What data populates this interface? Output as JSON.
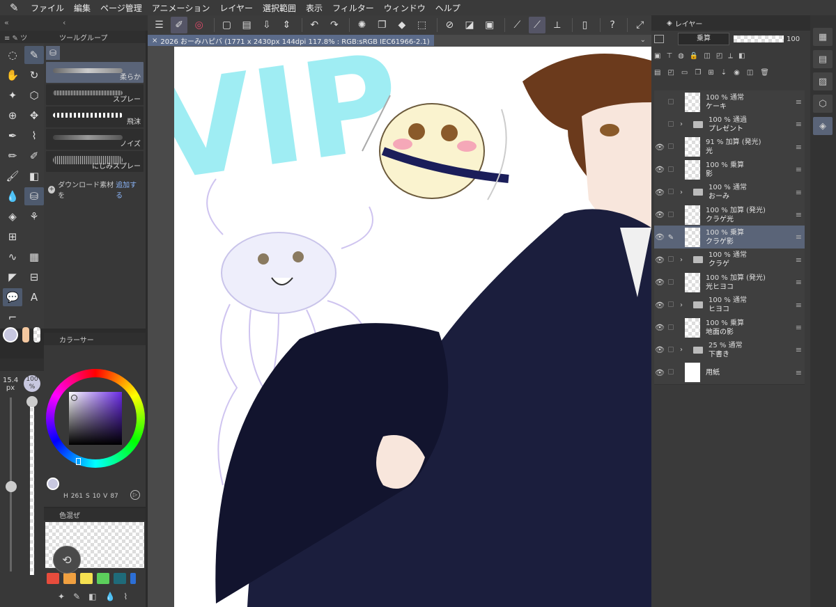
{
  "menu": [
    "ファイル",
    "編集",
    "ページ管理",
    "アニメーション",
    "レイヤー",
    "選択範囲",
    "表示",
    "フィルター",
    "ウィンドウ",
    "ヘルプ"
  ],
  "doc_tab": "2026 おーみハピバ (1771 x 2430px 144dpi 117.8% : RGB:sRGB IEC61966-2.1)",
  "subtool": {
    "header": "ツールグループ",
    "brushes": [
      "柔らか",
      "スプレー",
      "飛沫",
      "ノイズ",
      "にじみスプレー"
    ],
    "download_prefix": "ダウンロード素材を",
    "download_accent": "追加する"
  },
  "size_panel": {
    "size": "15.4",
    "size_unit": "px",
    "opacity": "100",
    "opacity_unit": "%"
  },
  "color_panel": {
    "header": "カラーサー",
    "h": "261",
    "s": "10",
    "v": "87",
    "h_label": "H",
    "s_label": "S",
    "v_label": "V"
  },
  "mix_panel": {
    "header": "色混ぜ",
    "swatches": [
      "#e74c3c",
      "#f0a040",
      "#f5e050",
      "#5ccf5c",
      "#1f6b7a",
      "#2c6fd6"
    ]
  },
  "layers_panel": {
    "tab": "レイヤー",
    "blend_mode": "乗算",
    "opacity_value": "100",
    "layers": [
      {
        "meta": "100 % 通常",
        "name": "ケーキ",
        "type": "layer",
        "visible": false,
        "selected": false
      },
      {
        "meta": "100 % 通過",
        "name": "プレゼント",
        "type": "folder",
        "visible": false,
        "selected": false
      },
      {
        "meta": "91 % 加算 (発光)",
        "name": "光",
        "type": "layer",
        "visible": true,
        "selected": false
      },
      {
        "meta": "100 % 乗算",
        "name": "影",
        "type": "layer",
        "visible": true,
        "selected": false
      },
      {
        "meta": "100 % 通常",
        "name": "おーみ",
        "type": "folder",
        "visible": true,
        "selected": false
      },
      {
        "meta": "100 % 加算 (発光)",
        "name": "クラゲ光",
        "type": "layer",
        "visible": true,
        "selected": false
      },
      {
        "meta": "100 % 乗算",
        "name": "クラゲ影",
        "type": "layer",
        "visible": true,
        "selected": true
      },
      {
        "meta": "100 % 通常",
        "name": "クラゲ",
        "type": "folder",
        "visible": true,
        "selected": false
      },
      {
        "meta": "100 % 加算 (発光)",
        "name": "光ヒヨコ",
        "type": "layer",
        "visible": true,
        "selected": false
      },
      {
        "meta": "100 % 通常",
        "name": "ヒヨコ",
        "type": "folder",
        "visible": true,
        "selected": false
      },
      {
        "meta": "100 % 乗算",
        "name": "地面の影",
        "type": "layer",
        "visible": true,
        "selected": false
      },
      {
        "meta": "25 % 通常",
        "name": "下書き",
        "type": "folder",
        "visible": true,
        "selected": false
      },
      {
        "meta": "",
        "name": "用紙",
        "type": "paper",
        "visible": true,
        "selected": false
      }
    ]
  },
  "artwork": {
    "text": "VIP"
  },
  "colors": {
    "accent": "#5a6478",
    "canvas_bg": "#ffffff",
    "panel": "#3a3a3a",
    "uniform": "#1b1e3d"
  }
}
